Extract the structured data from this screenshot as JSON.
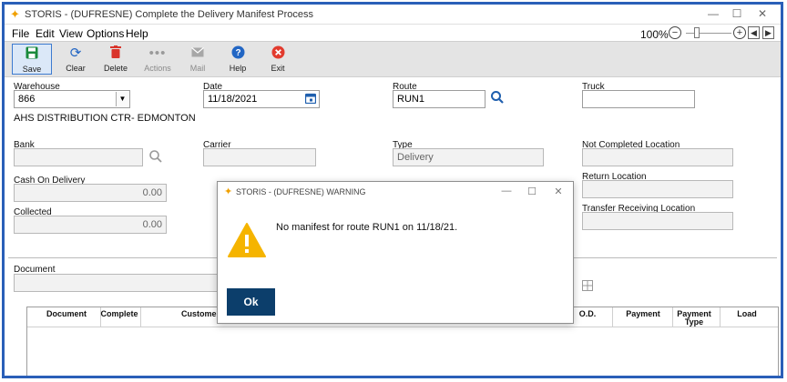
{
  "window": {
    "title": "STORIS - (DUFRESNE) Complete the Delivery Manifest Process",
    "controls": {
      "minimize": "—",
      "maximize": "☐",
      "close": "✕"
    }
  },
  "menu": {
    "items": [
      "File",
      "Edit",
      "View",
      "Options",
      "Help"
    ],
    "zoom": "100%",
    "zoom_level_percent": 100
  },
  "toolbar": {
    "buttons": [
      {
        "label": "Save",
        "icon": "save-icon",
        "state": "active"
      },
      {
        "label": "Clear",
        "icon": "refresh-icon",
        "state": "enabled"
      },
      {
        "label": "Delete",
        "icon": "trash-icon",
        "state": "enabled"
      },
      {
        "label": "Actions",
        "icon": "ellipsis-icon",
        "state": "disabled"
      },
      {
        "label": "Mail",
        "icon": "mail-icon",
        "state": "disabled"
      },
      {
        "label": "Help",
        "icon": "help-icon",
        "state": "enabled"
      },
      {
        "label": "Exit",
        "icon": "exit-icon",
        "state": "enabled"
      }
    ]
  },
  "form": {
    "warehouse": {
      "label": "Warehouse",
      "value": "866",
      "description": "AHS DISTRIBUTION CTR- EDMONTON"
    },
    "date": {
      "label": "Date",
      "value": "11/18/2021"
    },
    "route": {
      "label": "Route",
      "value": "RUN1"
    },
    "truck": {
      "label": "Truck",
      "value": ""
    },
    "bank": {
      "label": "Bank",
      "value": ""
    },
    "carrier": {
      "label": "Carrier",
      "value": ""
    },
    "type": {
      "label": "Type",
      "value": "Delivery"
    },
    "not_completed_location": {
      "label": "Not Completed Location",
      "value": ""
    },
    "return_location": {
      "label": "Return Location",
      "value": ""
    },
    "transfer_receiving_location": {
      "label": "Transfer Receiving Location",
      "value": ""
    },
    "cash_on_delivery": {
      "label": "Cash On Delivery",
      "value": "0.00"
    },
    "collected": {
      "label": "Collected",
      "value": "0.00"
    },
    "document": {
      "label": "Document",
      "value": ""
    }
  },
  "grid": {
    "columns": [
      "Document",
      "Complete",
      "Customer",
      "O.D.",
      "Payment",
      "Payment Type",
      "Load"
    ]
  },
  "dialog": {
    "title": "STORIS - (DUFRESNE) WARNING",
    "message": "No manifest for route RUN1 on 11/18/21.",
    "ok_label": "Ok"
  },
  "colors": {
    "frame_border": "#2a5fb8",
    "ok_button": "#0c3e6b",
    "warning": "#f5b400",
    "save_icon": "#1a8a3c",
    "refresh_icon": "#2266c4",
    "delete_icon": "#d9342b",
    "help_icon": "#2266c4",
    "exit_icon": "#e23b2e"
  }
}
